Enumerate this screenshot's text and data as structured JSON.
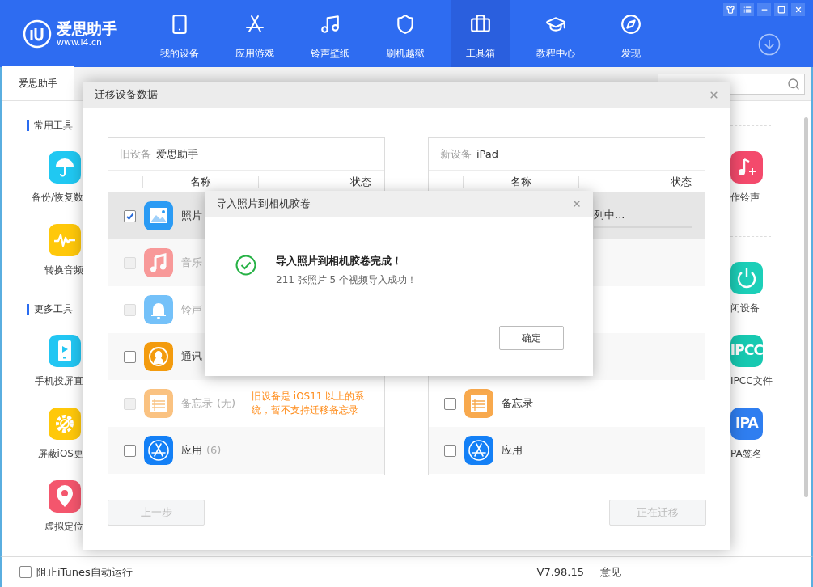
{
  "logo": {
    "name": "爱思助手",
    "url": "www.i4.cn"
  },
  "nav": [
    {
      "label": "我的设备",
      "kind": "device",
      "selected": false
    },
    {
      "label": "应用游戏",
      "kind": "apps",
      "selected": false
    },
    {
      "label": "铃声壁纸",
      "kind": "ringtones",
      "selected": false
    },
    {
      "label": "刷机越狱",
      "kind": "flash",
      "selected": false
    },
    {
      "label": "工具箱",
      "kind": "toolbox",
      "selected": true
    },
    {
      "label": "教程中心",
      "kind": "tutorials",
      "selected": false
    },
    {
      "label": "发现",
      "kind": "discover",
      "selected": false
    }
  ],
  "tabs": [
    {
      "label": "爱思助手",
      "selected": true
    }
  ],
  "tool_sections": [
    {
      "title": "常用工具",
      "left": [
        {
          "label": "备份/恢复数",
          "kind": "backup"
        },
        {
          "label": "转换音频",
          "kind": "audio"
        }
      ],
      "right": [
        {
          "label": "作铃声",
          "kind": "ringtone"
        }
      ]
    },
    {
      "title": "更多工具",
      "left": [
        {
          "label": "手机投屏直",
          "kind": "mirror"
        },
        {
          "label": "屏蔽iOS更",
          "kind": "block_update"
        },
        {
          "label": "虚拟定位",
          "kind": "location"
        }
      ],
      "right": [
        {
          "label": "闭设备",
          "kind": "power"
        },
        {
          "label": "IPCC文件",
          "kind": "ipcc",
          "badge": "IPCC"
        },
        {
          "label": "PA签名",
          "kind": "ipa",
          "badge": "IPA"
        }
      ]
    }
  ],
  "migrate_dialog": {
    "title": "迁移设备数据",
    "old_device": {
      "label": "旧设备",
      "name": "爱思助手",
      "columns": [
        "名称",
        "状态"
      ],
      "rows": [
        {
          "kind": "photos",
          "name": "照片",
          "checked": true,
          "disabled": false,
          "selected": true
        },
        {
          "kind": "music",
          "name": "音乐",
          "checked": false,
          "disabled": true,
          "selected": false
        },
        {
          "kind": "ringtones",
          "name": "铃声",
          "checked": false,
          "disabled": true,
          "selected": false
        },
        {
          "kind": "contacts",
          "name": "通讯",
          "checked": false,
          "disabled": false,
          "selected": false
        },
        {
          "kind": "notes",
          "name": "备忘录",
          "count": "(无)",
          "checked": false,
          "disabled": true,
          "selected": false,
          "note": "旧设备是 iOS11 以上的系统，暂不支持迁移备忘录"
        },
        {
          "kind": "apps",
          "name": "应用",
          "count": "(6)",
          "checked": false,
          "disabled": false,
          "selected": false
        }
      ]
    },
    "new_device": {
      "label": "新设备",
      "name": "iPad",
      "columns": [
        "名称",
        "状态"
      ],
      "rows": [
        {
          "selected": true,
          "status": "列中..."
        },
        {
          "selected": false
        },
        {
          "selected": false
        },
        {
          "selected": false
        },
        {
          "kind": "notes",
          "name": "备忘录",
          "checked": false,
          "disabled": false,
          "selected": false
        },
        {
          "kind": "apps",
          "name": "应用",
          "checked": false,
          "disabled": false,
          "selected": false
        }
      ]
    },
    "buttons": [
      {
        "label": "上一步",
        "disabled": true
      },
      {
        "label": "正在迁移",
        "disabled": true
      }
    ]
  },
  "import_dialog": {
    "title": "导入照片到相机胶卷",
    "message": "导入照片到相机胶卷完成！",
    "detail": "211 张照片 5 个视频导入成功！",
    "button": "确定"
  },
  "status_bar": {
    "itunes_block": {
      "label": "阻止iTunes自动运行",
      "checked": false
    },
    "version": "V7.98.15",
    "feedback": "意见"
  }
}
